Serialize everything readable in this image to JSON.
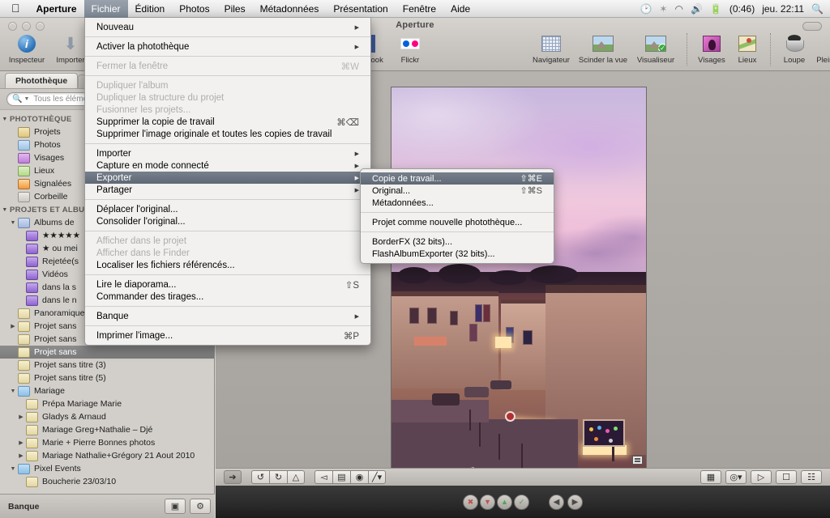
{
  "menubar": {
    "apple_icon": "apple-icon",
    "items": [
      {
        "label": "Aperture",
        "bold": true,
        "active": false
      },
      {
        "label": "Fichier",
        "bold": false,
        "active": true
      },
      {
        "label": "Édition",
        "bold": false,
        "active": false
      },
      {
        "label": "Photos",
        "bold": false,
        "active": false
      },
      {
        "label": "Piles",
        "bold": false,
        "active": false
      },
      {
        "label": "Métadonnées",
        "bold": false,
        "active": false
      },
      {
        "label": "Présentation",
        "bold": false,
        "active": false
      },
      {
        "label": "Fenêtre",
        "bold": false,
        "active": false
      },
      {
        "label": "Aide",
        "bold": false,
        "active": false
      }
    ],
    "status": {
      "timemachine_icon": "time-machine-icon",
      "bluetooth_icon": "bluetooth-icon",
      "wifi_icon": "wifi-icon",
      "volume_icon": "volume-icon",
      "battery_icon": "battery-icon",
      "battery_time": "(0:46)",
      "clock": "jeu. 22:11",
      "spotlight_icon": "search-icon"
    }
  },
  "window": {
    "title": "Aperture"
  },
  "toolbar": {
    "left_items": [
      {
        "label": "Inspecteur",
        "icon": "info-circle-icon"
      },
      {
        "label": "Importer",
        "icon": "download-arrow-icon"
      }
    ],
    "share_items": [
      {
        "label": "Facebook",
        "icon": "facebook-icon"
      },
      {
        "label": "Flickr",
        "icon": "flickr-icon"
      }
    ],
    "view_items": [
      {
        "label": "Navigateur",
        "icon": "grid-icon"
      },
      {
        "label": "Scinder la vue",
        "icon": "split-view-icon"
      },
      {
        "label": "Visualiseur",
        "icon": "viewer-icon"
      }
    ],
    "meta_items": [
      {
        "label": "Visages",
        "icon": "faces-icon"
      },
      {
        "label": "Lieux",
        "icon": "places-map-icon"
      }
    ],
    "tool_items": [
      {
        "label": "Loupe",
        "icon": "loupe-icon"
      },
      {
        "label": "Plein écran",
        "icon": "fullscreen-icon"
      }
    ]
  },
  "sidebar": {
    "tab_label": "Photothèque",
    "search_placeholder": "Tous les éléments",
    "sections": [
      {
        "header": "PHOTOTHÈQUE",
        "items": [
          {
            "label": "Projets",
            "icon": "projects-icon",
            "indent": 1
          },
          {
            "label": "Photos",
            "icon": "photos-icon",
            "indent": 1
          },
          {
            "label": "Visages",
            "icon": "faces-icon",
            "indent": 1
          },
          {
            "label": "Lieux",
            "icon": "places-icon",
            "indent": 1
          },
          {
            "label": "Signalées",
            "icon": "flag-icon",
            "indent": 1
          },
          {
            "label": "Corbeille",
            "icon": "trash-icon",
            "indent": 1
          }
        ]
      },
      {
        "header": "PROJETS ET ALBUMS",
        "items": [
          {
            "label": "Albums de",
            "icon": "smart-albums-icon",
            "indent": 1,
            "disclosure": "open"
          },
          {
            "label": "★★★★★",
            "icon": "smart-album-icon",
            "indent": 2
          },
          {
            "label": "★ ou mei",
            "icon": "smart-album-icon",
            "indent": 2
          },
          {
            "label": "Rejetée(s",
            "icon": "smart-album-icon",
            "indent": 2
          },
          {
            "label": "Vidéos",
            "icon": "smart-album-icon",
            "indent": 2
          },
          {
            "label": "dans la s",
            "icon": "smart-album-icon",
            "indent": 2
          },
          {
            "label": "dans le n",
            "icon": "smart-album-icon",
            "indent": 2
          },
          {
            "label": "Panoramiques",
            "icon": "album-icon",
            "indent": 1
          },
          {
            "label": "Projet sans",
            "icon": "album-icon",
            "indent": 1,
            "disclosure": "closed"
          },
          {
            "label": "Projet sans",
            "icon": "album-icon",
            "indent": 1
          },
          {
            "label": "Projet sans",
            "icon": "album-icon",
            "indent": 1,
            "selected": true
          },
          {
            "label": "Projet sans titre (3)",
            "icon": "album-icon",
            "indent": 1
          },
          {
            "label": "Projet sans titre (5)",
            "icon": "album-icon",
            "indent": 1
          },
          {
            "label": "Mariage",
            "icon": "folder-icon",
            "indent": 1,
            "disclosure": "open"
          },
          {
            "label": "Prépa Mariage Marie",
            "icon": "album-icon",
            "indent": 2
          },
          {
            "label": "Gladys & Arnaud",
            "icon": "album-icon",
            "indent": 2,
            "disclosure": "closed"
          },
          {
            "label": "Mariage Greg+Nathalie – Djé",
            "icon": "album-icon",
            "indent": 2
          },
          {
            "label": "Marie + Pierre Bonnes photos",
            "icon": "album-icon",
            "indent": 2,
            "disclosure": "closed"
          },
          {
            "label": "Mariage Nathalie+Grégory 21 Aout 2010",
            "icon": "album-icon",
            "indent": 2,
            "disclosure": "closed"
          },
          {
            "label": "Pixel Events",
            "icon": "folder-icon",
            "indent": 1,
            "disclosure": "open"
          },
          {
            "label": "Boucherie 23/03/10",
            "icon": "album-icon",
            "indent": 2
          }
        ]
      }
    ],
    "bottom": {
      "label": "Banque",
      "buttons": [
        {
          "icon": "new-album-icon"
        },
        {
          "icon": "gear-icon"
        }
      ]
    }
  },
  "file_menu": {
    "groups": [
      [
        {
          "label": "Nouveau",
          "submenu": true,
          "enabled": true
        }
      ],
      [
        {
          "label": "Activer la photothèque",
          "submenu": true,
          "enabled": true
        }
      ],
      [
        {
          "label": "Fermer la fenêtre",
          "shortcut": "⌘W",
          "enabled": false
        }
      ],
      [
        {
          "label": "Dupliquer l'album",
          "enabled": false
        },
        {
          "label": "Dupliquer la structure du projet",
          "enabled": false
        },
        {
          "label": "Fusionner les projets...",
          "enabled": false
        },
        {
          "label": "Supprimer la copie de travail",
          "shortcut": "⌘⌫",
          "enabled": true
        },
        {
          "label": "Supprimer l'image originale et toutes les copies de travail",
          "enabled": true
        }
      ],
      [
        {
          "label": "Importer",
          "submenu": true,
          "enabled": true
        },
        {
          "label": "Capture en mode connecté",
          "submenu": true,
          "enabled": true
        },
        {
          "label": "Exporter",
          "submenu": true,
          "enabled": true,
          "highlighted": true
        },
        {
          "label": "Partager",
          "submenu": true,
          "enabled": true
        }
      ],
      [
        {
          "label": "Déplacer l'original...",
          "enabled": true
        },
        {
          "label": "Consolider l'original...",
          "enabled": true
        }
      ],
      [
        {
          "label": "Afficher dans le projet",
          "enabled": false
        },
        {
          "label": "Afficher dans le Finder",
          "enabled": false
        },
        {
          "label": "Localiser les fichiers référencés...",
          "enabled": true
        }
      ],
      [
        {
          "label": "Lire le diaporama...",
          "shortcut": "⇧S",
          "enabled": true
        },
        {
          "label": "Commander des tirages...",
          "enabled": true
        }
      ],
      [
        {
          "label": "Banque",
          "submenu": true,
          "enabled": true
        }
      ],
      [
        {
          "label": "Imprimer l'image...",
          "shortcut": "⌘P",
          "enabled": true
        }
      ]
    ]
  },
  "export_submenu": {
    "groups": [
      [
        {
          "label": "Copie de travail...",
          "shortcut": "⇧⌘E",
          "highlighted": true
        },
        {
          "label": "Original...",
          "shortcut": "⇧⌘S"
        },
        {
          "label": "Métadonnées...",
          "shortcut": ""
        }
      ],
      [
        {
          "label": "Projet comme nouvelle photothèque...",
          "shortcut": ""
        }
      ],
      [
        {
          "label": "BorderFX (32 bits)...",
          "shortcut": ""
        },
        {
          "label": "FlashAlbumExporter (32 bits)...",
          "shortcut": ""
        }
      ]
    ]
  },
  "viewer_toolbar": {
    "left_groups": [
      [
        {
          "icon": "cursor-arrow-icon",
          "active": true
        }
      ],
      [
        {
          "icon": "rotate-left-icon"
        },
        {
          "icon": "rotate-right-icon"
        },
        {
          "icon": "straighten-icon"
        }
      ],
      [
        {
          "icon": "flip-icon"
        },
        {
          "icon": "crop-icon"
        },
        {
          "icon": "redeye-icon"
        },
        {
          "icon": "retouch-brush-icon"
        }
      ]
    ],
    "right_buttons": [
      {
        "icon": "slideshow-icon"
      },
      {
        "icon": "keywords-icon"
      },
      {
        "icon": "metadata-icon"
      },
      {
        "icon": "single-view-icon"
      },
      {
        "icon": "filmstrip-icon"
      }
    ]
  },
  "rating_bar": {
    "buttons": [
      {
        "icon": "reject-icon",
        "color": "#c45050"
      },
      {
        "icon": "rating-down-icon",
        "color": "#c45050"
      },
      {
        "icon": "rating-up-icon",
        "color": "#4fa54f"
      },
      {
        "icon": "select-check-icon",
        "color": "#4fa54f"
      }
    ],
    "nav": [
      {
        "icon": "arrow-left-icon"
      },
      {
        "icon": "arrow-right-icon"
      }
    ]
  }
}
